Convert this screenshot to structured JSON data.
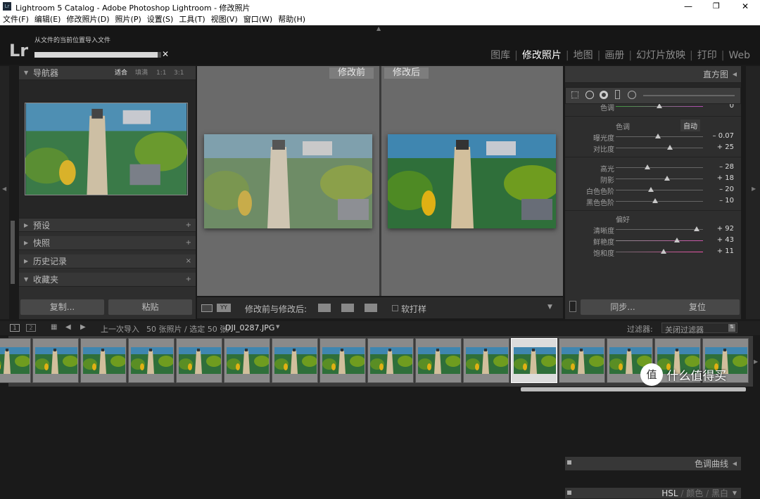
{
  "window": {
    "title": "Lightroom 5 Catalog - Adobe Photoshop Lightroom - 修改照片",
    "controls": [
      "—",
      "❐",
      "✕"
    ]
  },
  "menu": [
    "文件(F)",
    "编辑(E)",
    "修改照片(D)",
    "照片(P)",
    "设置(S)",
    "工具(T)",
    "视图(V)",
    "窗口(W)",
    "帮助(H)"
  ],
  "identity": {
    "logo": "Lr",
    "status": "从文件的当前位置导入文件",
    "progress": 0.97,
    "modules": [
      {
        "label": "图库",
        "active": false
      },
      {
        "label": "修改照片",
        "active": true
      },
      {
        "label": "地图",
        "active": false
      },
      {
        "label": "画册",
        "active": false
      },
      {
        "label": "幻灯片放映",
        "active": false
      },
      {
        "label": "打印",
        "active": false
      },
      {
        "label": "Web",
        "active": false
      }
    ]
  },
  "left": {
    "navigator": {
      "title": "导航器",
      "zoom": [
        "适合",
        "填满",
        "1:1",
        "3:1"
      ]
    },
    "panels": [
      {
        "label": "预设",
        "action": "+"
      },
      {
        "label": "快照",
        "action": "+"
      },
      {
        "label": "历史记录",
        "action": "×"
      },
      {
        "label": "收藏夹",
        "action": "+"
      }
    ],
    "copy_label": "复制...",
    "paste_label": "粘贴"
  },
  "center": {
    "before_label": "修改前",
    "after_label": "修改后",
    "toolbar": {
      "mode_label": "修改前与修改后:",
      "softproof_label": "软打样"
    }
  },
  "right": {
    "histogram_title": "直方图",
    "tint_label": "色调",
    "tint_value": "0",
    "tone_header": "色调",
    "auto_label": "自动",
    "tone_sliders": [
      {
        "label": "曝光度",
        "value": "– 0.07",
        "pos": 0.48
      },
      {
        "label": "对比度",
        "value": "+ 25",
        "pos": 0.62
      }
    ],
    "presence_sliders": [
      {
        "label": "高光",
        "value": "– 28",
        "pos": 0.36
      },
      {
        "label": "阴影",
        "value": "+ 18",
        "pos": 0.59
      },
      {
        "label": "白色色阶",
        "value": "– 20",
        "pos": 0.4
      },
      {
        "label": "黑色色阶",
        "value": "– 10",
        "pos": 0.45
      }
    ],
    "pref_header": "偏好",
    "pref_sliders": [
      {
        "label": "清晰度",
        "value": "+ 92",
        "pos": 0.93
      },
      {
        "label": "鲜艳度",
        "value": "+ 43",
        "pos": 0.7
      },
      {
        "label": "饱和度",
        "value": "+ 11",
        "pos": 0.55
      }
    ],
    "tone_curve_label": "色调曲线",
    "hsl_labels": [
      "HSL",
      "颜色",
      "黑白"
    ],
    "sync_label": "同步...",
    "reset_label": "复位"
  },
  "filmstrip": {
    "source": "上一次导入",
    "count": "50 张照片 / 选定 50 张/",
    "filename": "DJI_0287.JPG",
    "filter_label": "过滤器:",
    "filter_value": "关闭过滤器",
    "thumb_count": 16,
    "selected_index": 11
  },
  "watermark": {
    "text": "什么值得买"
  },
  "colors": {
    "panel": "#2e2e2e",
    "center": "#6a6a6a",
    "accent": "#ffffff"
  }
}
